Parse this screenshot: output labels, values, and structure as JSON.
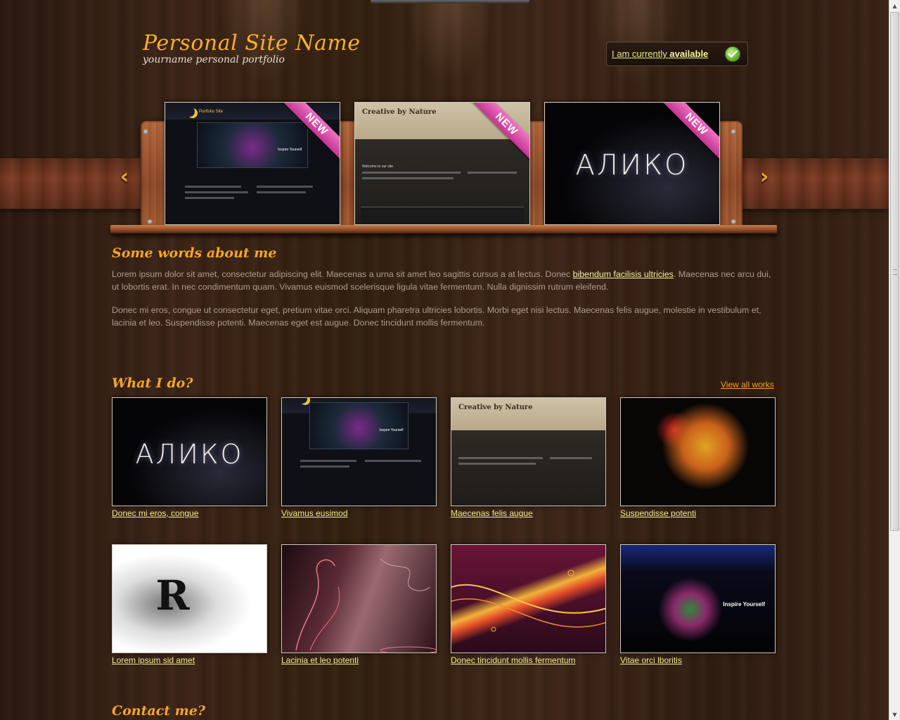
{
  "header": {
    "site_title": "Personal Site Name",
    "site_subtitle": "yourname personal portfolio",
    "availability_prefix": "I am currently ",
    "availability_status": "available"
  },
  "showcase": {
    "ribbon_label": "NEW",
    "items": [
      {
        "title": "Portfolio Site",
        "screen_label": "Inspire Yourself"
      },
      {
        "title": "Creative by Nature",
        "subtitle": "Welcome to our site"
      },
      {
        "title": "АЛИКО"
      }
    ]
  },
  "about": {
    "heading": "Some words about me",
    "paragraph1_before": "Lorem ipsum dolor sit amet, consectetur adipiscing elit. Maecenas a urna sit amet leo sagittis cursus a at lectus. Donec ",
    "paragraph1_link": "bibendum facilisis ultricies",
    "paragraph1_after": ". Maecenas nec arcu dui, ut lobortis erat. In nec condimentum quam. Vivamus euismod scelerisque ligula vitae fermentum. Nulla dignissim rutrum eleifend.",
    "paragraph2": "Donec mi eros, congue ut consectetur eget, pretium vitae orci. Aliquam pharetra ultricies lobortis. Morbi eget nisi lectus. Maecenas felis augue, molestie in vestibulum et, lacinia et leo. Suspendisse potenti. Maecenas eget est augue. Donec tincidunt mollis fermentum."
  },
  "works": {
    "heading": "What I do?",
    "view_all_label": "View all works",
    "items": [
      {
        "caption": "Donec mi eros, congue",
        "thumb_text": "АЛИКО"
      },
      {
        "caption": "Vivamus eusimod",
        "thumb_text": "Inspire Yourself"
      },
      {
        "caption": "Maecenas felis augue",
        "thumb_text": "Creative by Nature"
      },
      {
        "caption": "Suspendisse potenti"
      },
      {
        "caption": "Lorem ipsum sid amet",
        "thumb_text": "R"
      },
      {
        "caption": "Lacinia et leo potenti"
      },
      {
        "caption": "Donec tincidunt mollis fermentum"
      },
      {
        "caption": "Vitae orci lboritis",
        "thumb_text": "Inspire Yourself"
      }
    ]
  },
  "contact": {
    "heading": "Contact me?"
  },
  "icons": {
    "prev": "chevron-left-icon",
    "next": "chevron-right-icon",
    "available": "check-icon"
  },
  "colors": {
    "accent_orange": "#f5a726",
    "link_yellow": "#f2ec90",
    "ribbon_pink": "#e052b0",
    "wood_dark": "#33200f"
  }
}
